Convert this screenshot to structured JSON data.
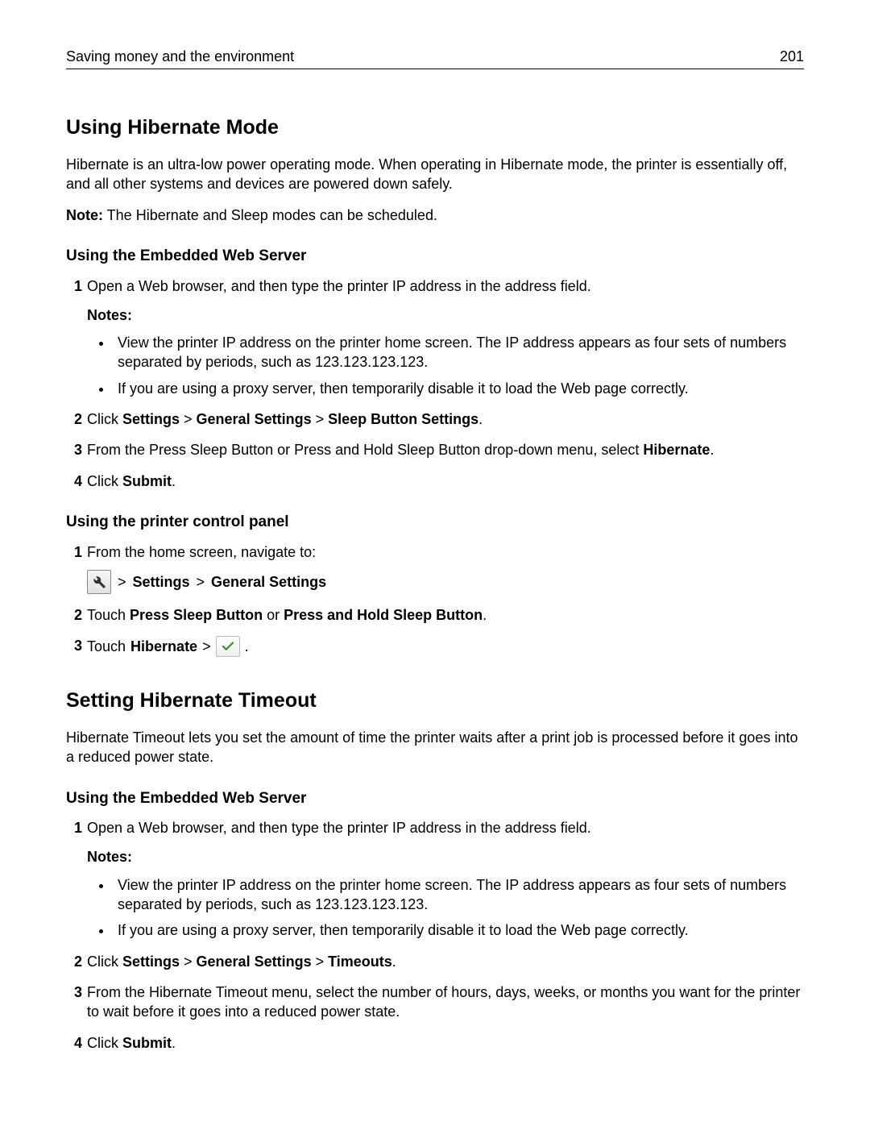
{
  "header": {
    "section_title": "Saving money and the environment",
    "page_number": "201"
  },
  "hibernate_mode": {
    "heading": "Using Hibernate Mode",
    "intro": "Hibernate is an ultra‑low power operating mode. When operating in Hibernate mode, the printer is essentially off, and all other systems and devices are powered down safely.",
    "note_label": "Note:",
    "note_text": " The Hibernate and Sleep modes can be scheduled.",
    "subheading_ews": "Using the Embedded Web Server",
    "steps_ews": {
      "1": {
        "text": "Open a Web browser, and then type the printer IP address in the address field.",
        "notes_label": "Notes:",
        "bullets": [
          "View the printer IP address on the printer home screen. The IP address appears as four sets of numbers separated by periods, such as 123.123.123.123.",
          "If you are using a proxy server, then temporarily disable it to load the Web page correctly."
        ]
      },
      "2_pre": "Click ",
      "2_b1": "Settings",
      "2_sep": " > ",
      "2_b2": "General Settings",
      "2_b3": "Sleep Button Settings",
      "2_post": ".",
      "3_pre": "From the Press Sleep Button or Press and Hold Sleep Button drop‑down menu, select ",
      "3_b": "Hibernate",
      "3_post": ".",
      "4_pre": "Click ",
      "4_b": "Submit",
      "4_post": "."
    },
    "subheading_panel": "Using the printer control panel",
    "steps_panel": {
      "1_text": "From the home screen, navigate to:",
      "1_nav_sep": " > ",
      "1_nav_b1": "Settings",
      "1_nav_b2": "General Settings",
      "2_pre": "Touch ",
      "2_b1": "Press Sleep Button",
      "2_mid": " or ",
      "2_b2": "Press and Hold Sleep Button",
      "2_post": ".",
      "3_pre": "Touch ",
      "3_b": "Hibernate",
      "3_sep": " > ",
      "3_post": " ."
    }
  },
  "hibernate_timeout": {
    "heading": "Setting Hibernate Timeout",
    "intro": "Hibernate Timeout lets you set the amount of time the printer waits after a print job is processed before it goes into a reduced power state.",
    "subheading_ews": "Using the Embedded Web Server",
    "steps_ews": {
      "1": {
        "text": "Open a Web browser, and then type the printer IP address in the address field.",
        "notes_label": "Notes:",
        "bullets": [
          "View the printer IP address on the printer home screen. The IP address appears as four sets of numbers separated by periods, such as 123.123.123.123.",
          "If you are using a proxy server, then temporarily disable it to load the Web page correctly."
        ]
      },
      "2_pre": "Click ",
      "2_b1": "Settings",
      "2_sep": " > ",
      "2_b2": "General Settings",
      "2_b3": "Timeouts",
      "2_post": ".",
      "3_text": "From the Hibernate Timeout menu, select the number of hours, days, weeks, or months you want for the printer to wait before it goes into a reduced power state.",
      "4_pre": "Click ",
      "4_b": "Submit",
      "4_post": "."
    }
  },
  "step_numbers": {
    "n1": "1",
    "n2": "2",
    "n3": "3",
    "n4": "4"
  }
}
